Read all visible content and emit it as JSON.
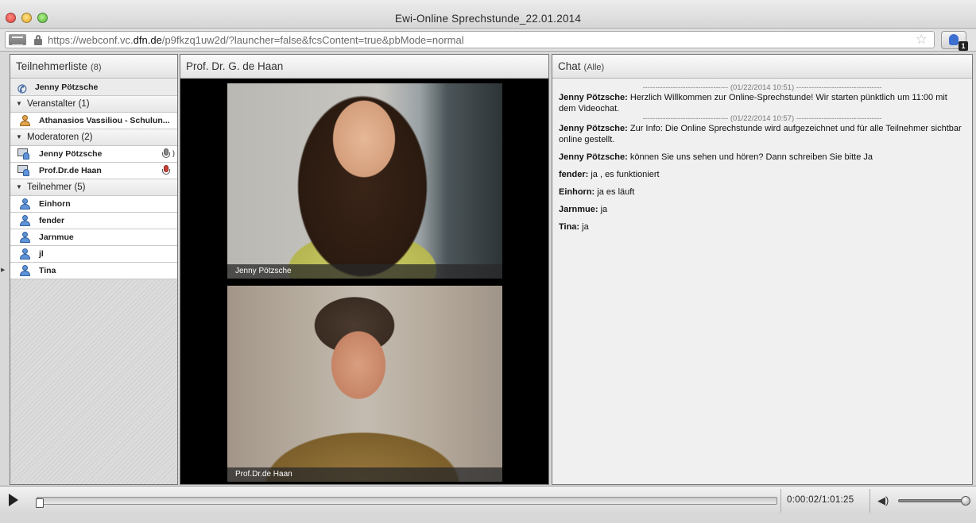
{
  "window": {
    "title": "Ewi-Online Sprechstunde_22.01.2014"
  },
  "address_bar": {
    "url_prefix": "https://webconf.vc.",
    "url_host": "dfn.de",
    "url_path": "/p9fkzq1uw2d/?launcher=false&fcsContent=true&pbMode=normal",
    "extension_badge": "1"
  },
  "participants": {
    "title": "Teilnehmerliste",
    "count": "(8)",
    "self": "Jenny Pötzsche",
    "groups": [
      {
        "label": "Veranstalter (1)",
        "members": [
          {
            "name": "Athanasios Vassiliou - Schulun...",
            "icon": "host-user-icon"
          }
        ]
      },
      {
        "label": "Moderatoren (2)",
        "members": [
          {
            "name": "Jenny Pötzsche",
            "icon": "presenter-icon",
            "audio": "speaking-mic-icon"
          },
          {
            "name": "Prof.Dr.de Haan",
            "icon": "presenter-icon",
            "audio": "muted-mic-icon"
          }
        ]
      },
      {
        "label": "Teilnehmer (5)",
        "members": [
          {
            "name": "Einhorn",
            "icon": "user-icon"
          },
          {
            "name": "fender",
            "icon": "user-icon"
          },
          {
            "name": "Jarnmue",
            "icon": "user-icon"
          },
          {
            "name": "jl",
            "icon": "user-icon"
          },
          {
            "name": "Tina",
            "icon": "user-icon"
          }
        ]
      }
    ]
  },
  "video": {
    "title": "Prof. Dr. G. de Haan",
    "feeds": [
      {
        "label": "Jenny Pötzsche"
      },
      {
        "label": "Prof.Dr.de Haan"
      }
    ]
  },
  "chat": {
    "title": "Chat",
    "scope": "(Alle)",
    "entries": [
      {
        "type": "sep",
        "text": "---------------------------------- (01/22/2014 10:51) ----------------------------------"
      },
      {
        "type": "msg",
        "who": "Jenny Pötzsche:",
        "text": " Herzlich Willkommen zur Online-Sprechstunde! Wir starten pünktlich um 11:00 mit dem Videochat.",
        "nospace": true
      },
      {
        "type": "sep",
        "text": "---------------------------------- (01/22/2014 10:57) ----------------------------------"
      },
      {
        "type": "msg",
        "who": "Jenny Pötzsche:",
        "text": " Zur Info: Die Online Sprechstunde wird aufgezeichnet und für alle Teilnehmer sichtbar online gestellt."
      },
      {
        "type": "msg",
        "who": "Jenny Pötzsche:",
        "text": " können Sie uns sehen und hören? Dann schreiben Sie bitte Ja"
      },
      {
        "type": "msg",
        "who": "fender:",
        "text": " ja , es funktioniert"
      },
      {
        "type": "msg",
        "who": "Einhorn:",
        "text": " ja es läuft"
      },
      {
        "type": "msg",
        "who": "Jarnmue:",
        "text": " ja"
      },
      {
        "type": "msg",
        "who": "Tina:",
        "text": " ja"
      }
    ]
  },
  "playback": {
    "time": "0:00:02/1:01:25",
    "progress_fraction": 0.0005,
    "volume_fraction": 1.0
  }
}
